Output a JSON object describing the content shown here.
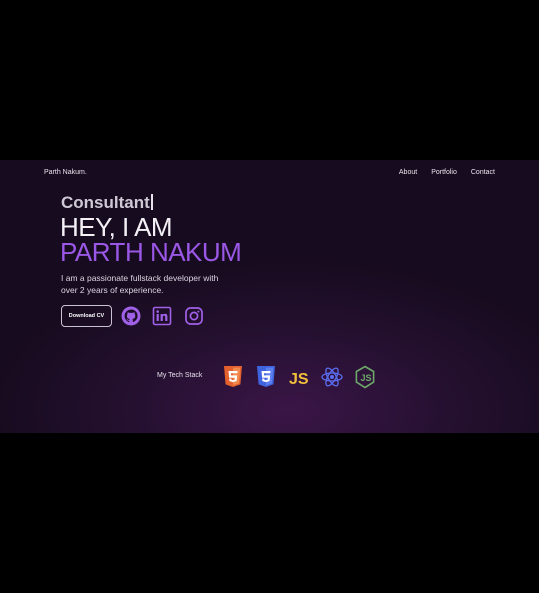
{
  "header": {
    "brand": "Parth Nakum.",
    "nav": [
      "About",
      "Portfolio",
      "Contact"
    ]
  },
  "hero": {
    "typed_role": "Consultant",
    "greeting": "HEY, I AM",
    "name": "PARTH NAKUM",
    "bio_line1": "I am a passionate fullstack developer with",
    "bio_line2": "over 2 years of experience.",
    "download_label": "Download CV"
  },
  "social_icons": [
    "github-icon",
    "linkedin-icon",
    "instagram-icon"
  ],
  "tech_stack": {
    "label": "My Tech Stack",
    "icons": [
      "html5-icon",
      "css3-icon",
      "javascript-icon",
      "react-icon",
      "nodejs-icon"
    ]
  },
  "colors": {
    "accent": "#9b57e6",
    "background": "#1c0d26",
    "html": "#e4612d",
    "css": "#3f64e0",
    "js": "#f0c03a",
    "react": "#5b6ef2",
    "node": "#6ea96a"
  }
}
